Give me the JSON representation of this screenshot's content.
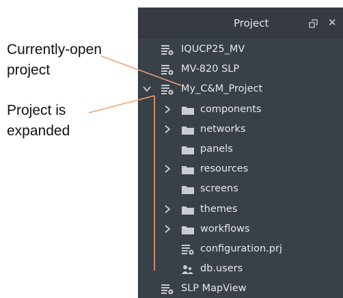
{
  "panel": {
    "title": "Project",
    "restore_icon": "restore-window-icon",
    "close_label": "✕"
  },
  "tree": {
    "items": [
      {
        "label": "IQUCP25_MV",
        "icon": "project-file-icon",
        "depth": 0,
        "chevron": "none"
      },
      {
        "label": "MV-820 SLP",
        "icon": "project-file-icon",
        "depth": 0,
        "chevron": "none"
      },
      {
        "label": "My_C&M_Project",
        "icon": "project-file-icon",
        "depth": 0,
        "chevron": "expanded"
      },
      {
        "label": "components",
        "icon": "folder-icon",
        "depth": 1,
        "chevron": "collapsed"
      },
      {
        "label": "networks",
        "icon": "folder-icon",
        "depth": 1,
        "chevron": "collapsed"
      },
      {
        "label": "panels",
        "icon": "folder-icon",
        "depth": 1,
        "chevron": "none"
      },
      {
        "label": "resources",
        "icon": "folder-icon",
        "depth": 1,
        "chevron": "collapsed"
      },
      {
        "label": "screens",
        "icon": "folder-icon",
        "depth": 1,
        "chevron": "none"
      },
      {
        "label": "themes",
        "icon": "folder-icon",
        "depth": 1,
        "chevron": "collapsed"
      },
      {
        "label": "workflows",
        "icon": "folder-icon",
        "depth": 1,
        "chevron": "collapsed"
      },
      {
        "label": "configuration.prj",
        "icon": "project-file-icon",
        "depth": 1,
        "chevron": "none"
      },
      {
        "label": "db.users",
        "icon": "users-icon",
        "depth": 1,
        "chevron": "none"
      },
      {
        "label": "SLP MapView",
        "icon": "project-file-icon",
        "depth": 0,
        "chevron": "none"
      }
    ]
  },
  "annotations": {
    "open_line1": "Currently-open",
    "open_line2": "project",
    "expanded_line1": "Project is",
    "expanded_line2": "expanded",
    "line_color": "#f0a070"
  },
  "colors": {
    "panel_bg": "#3a4048",
    "text": "#e6e8ec",
    "icon": "#c9ccd2"
  }
}
